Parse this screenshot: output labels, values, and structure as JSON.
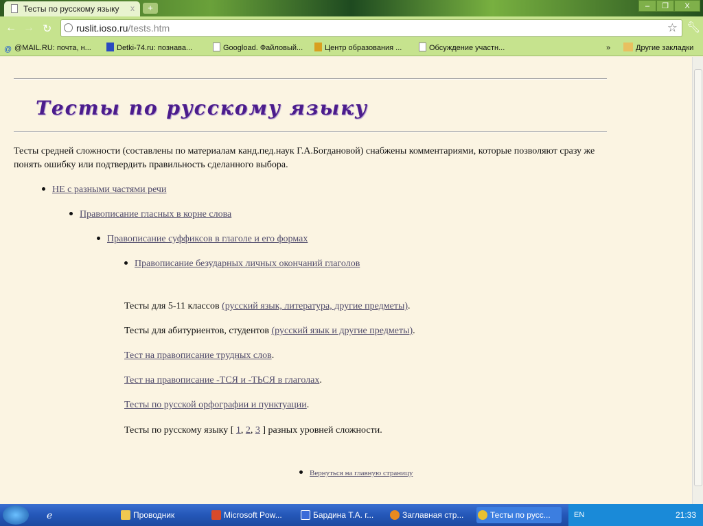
{
  "browser": {
    "tab_title": "Тесты по русскому языку",
    "tab_close": "x",
    "new_tab": "+",
    "url_host": "ruslit.ioso.ru",
    "url_path": "/tests.htm",
    "window_buttons": [
      "–",
      "❐",
      "X"
    ]
  },
  "bookmarks": [
    {
      "label": "@MAIL.RU: почта, н...",
      "icon": "at-icon"
    },
    {
      "label": "Detki-74.ru: познава...",
      "icon": "site-icon"
    },
    {
      "label": "Googload. Файловый...",
      "icon": "page-icon"
    },
    {
      "label": "Центр образования ...",
      "icon": "site-icon"
    },
    {
      "label": "Обсуждение участн...",
      "icon": "page-icon"
    }
  ],
  "bookmarks_more": "»",
  "other_bookmarks": "Другие закладки",
  "page": {
    "heading": "Тесты по русскому языку",
    "intro": "Тесты средней сложности (составлены по материалам канд.пед.наук Г.А.Богдановой) снабжены комментариями, которые позволяют сразу же понять ошибку или подтвердить правильность сделанного выбора.",
    "list": [
      "НЕ с разными частями речи",
      "Правописание гласных в корне слова",
      "Правописание суффиксов в глаголе и его формах",
      "Правописание безударных личных окончаний глаголов"
    ],
    "line1_text": "Тесты для 5-11 классов ",
    "line1_link": "(русский язык, литература, другие предметы)",
    "line2_text": "Тесты для абитуриентов, студентов ",
    "line2_link": "(русский язык и другие предметы)",
    "line3_link": "Тест на правописание трудных слов",
    "line4_link": "Тест на правописание -ТСЯ и -ТЬСЯ в глаголах",
    "line5_link": "Тесты по русской орфографии и пунктуации",
    "line6_pre": "Тесты по русскому языку [ ",
    "line6_links": [
      "1",
      "2",
      "3"
    ],
    "line6_post": " ] разных уровней сложности.",
    "period": ".",
    "comma": ", ",
    "back_link": "Вернуться на главную страницу"
  },
  "taskbar": {
    "items": [
      "Проводник",
      "Microsoft Pow...",
      "Бардина Т.А. г...",
      "Заглавная стр...",
      "Тесты по русс..."
    ],
    "lang": "EN",
    "time": "21:33"
  }
}
